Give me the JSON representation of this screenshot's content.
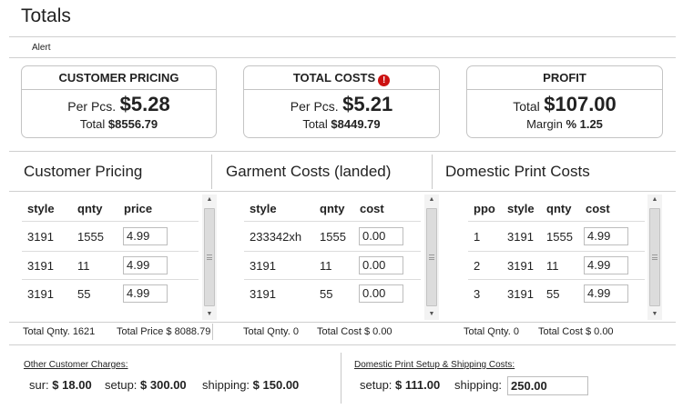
{
  "page_title": "Totals",
  "alert_label": "Alert",
  "cards": {
    "customer_pricing": {
      "title": "CUSTOMER PRICING",
      "per_label": "Per Pcs.",
      "per_value": "$5.28",
      "total_label": "Total",
      "total_value": "$8556.79"
    },
    "total_costs": {
      "title": "TOTAL COSTS",
      "alert_icon_glyph": "!",
      "per_label": "Per Pcs.",
      "per_value": "$5.21",
      "total_label": "Total",
      "total_value": "$8449.79"
    },
    "profit": {
      "title": "PROFIT",
      "total_label": "Total",
      "total_value": "$107.00",
      "margin_label": "Margin",
      "margin_value": "% 1.25"
    }
  },
  "sections": {
    "customer_pricing": {
      "title": "Customer Pricing",
      "headers": [
        "style",
        "qnty",
        "price"
      ],
      "rows": [
        {
          "style": "3191",
          "qnty": "1555",
          "price": "4.99"
        },
        {
          "style": "3191",
          "qnty": "11",
          "price": "4.99"
        },
        {
          "style": "3191",
          "qnty": "55",
          "price": "4.99"
        }
      ],
      "footer_qnty": "Total Qnty. 1621",
      "footer_total": "Total Price $ 8088.79"
    },
    "garment_costs": {
      "title": "Garment Costs (landed)",
      "headers": [
        "style",
        "qnty",
        "cost"
      ],
      "rows": [
        {
          "style": "233342xh",
          "qnty": "1555",
          "cost": "0.00"
        },
        {
          "style": "3191",
          "qnty": "11",
          "cost": "0.00"
        },
        {
          "style": "3191",
          "qnty": "55",
          "cost": "0.00"
        }
      ],
      "footer_qnty": "Total Qnty. 0",
      "footer_total": "Total Cost $  0.00"
    },
    "domestic_print": {
      "title": "Domestic Print Costs",
      "headers": [
        "ppo",
        "style",
        "qnty",
        "cost"
      ],
      "rows": [
        {
          "ppo": "1",
          "style": "3191",
          "qnty": "1555",
          "cost": "4.99"
        },
        {
          "ppo": "2",
          "style": "3191",
          "qnty": "11",
          "cost": "4.99"
        },
        {
          "ppo": "3",
          "style": "3191",
          "qnty": "55",
          "cost": "4.99"
        }
      ],
      "footer_qnty": "Total Qnty. 0",
      "footer_total": "Total Cost $  0.00"
    }
  },
  "scroll_arrows": {
    "up": "▲",
    "down": "▼"
  },
  "other_charges": {
    "title": "Other Customer Charges:",
    "sur_label": "sur:",
    "sur_value": "$ 18.00",
    "setup_label": "setup:",
    "setup_value": "$ 300.00",
    "shipping_label": "shipping:",
    "shipping_value": "$ 150.00"
  },
  "domestic_setup": {
    "title": "Domestic Print Setup & Shipping Costs:",
    "setup_label": "setup:",
    "setup_value": "$ 111.00",
    "shipping_label": "shipping:",
    "shipping_value": "250.00"
  }
}
